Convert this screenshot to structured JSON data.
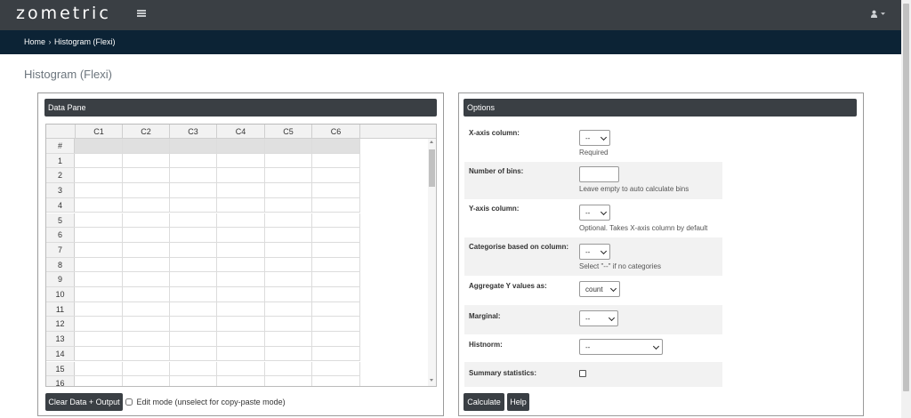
{
  "app": {
    "brand": "zometric"
  },
  "breadcrumb": {
    "home": "Home",
    "separator": "›",
    "current": "Histogram (Flexi)"
  },
  "page_title": "Histogram (Flexi)",
  "data_pane": {
    "title": "Data Pane",
    "columns": [
      "C1",
      "C2",
      "C3",
      "C4",
      "C5",
      "C6"
    ],
    "row_header_label": "#",
    "rows": [
      "1",
      "2",
      "3",
      "4",
      "5",
      "6",
      "7",
      "8",
      "9",
      "10",
      "11",
      "12",
      "13",
      "14",
      "15",
      "16"
    ],
    "clear_button": "Clear Data + Output",
    "edit_mode_label": "Edit mode (unselect for copy-paste mode)",
    "edit_mode_checked": false
  },
  "options": {
    "title": "Options",
    "x_axis": {
      "label": "X-axis column:",
      "value": "--",
      "hint": "Required"
    },
    "bins": {
      "label": "Number of bins:",
      "value": "",
      "hint": "Leave empty to auto calculate bins"
    },
    "y_axis": {
      "label": "Y-axis column:",
      "value": "--",
      "hint": "Optional. Takes X-axis column by default"
    },
    "categorise": {
      "label": "Categorise based on column:",
      "value": "--",
      "hint": "Select \"--\" if no categories"
    },
    "aggregate": {
      "label": "Aggregate Y values as:",
      "value": "count"
    },
    "marginal": {
      "label": "Marginal:",
      "value": "--"
    },
    "histnorm": {
      "label": "Histnorm:",
      "value": "--"
    },
    "summary": {
      "label": "Summary statistics:",
      "checked": false
    },
    "calculate_button": "Calculate",
    "help_button": "Help"
  },
  "colors": {
    "navbar": "#3a3f44",
    "breadcrumb_bar": "#0c2335",
    "panel_header": "#3a3f44"
  },
  "icons": {
    "menu": "hamburger-icon",
    "user": "user-icon",
    "caret": "caret-down-icon"
  }
}
